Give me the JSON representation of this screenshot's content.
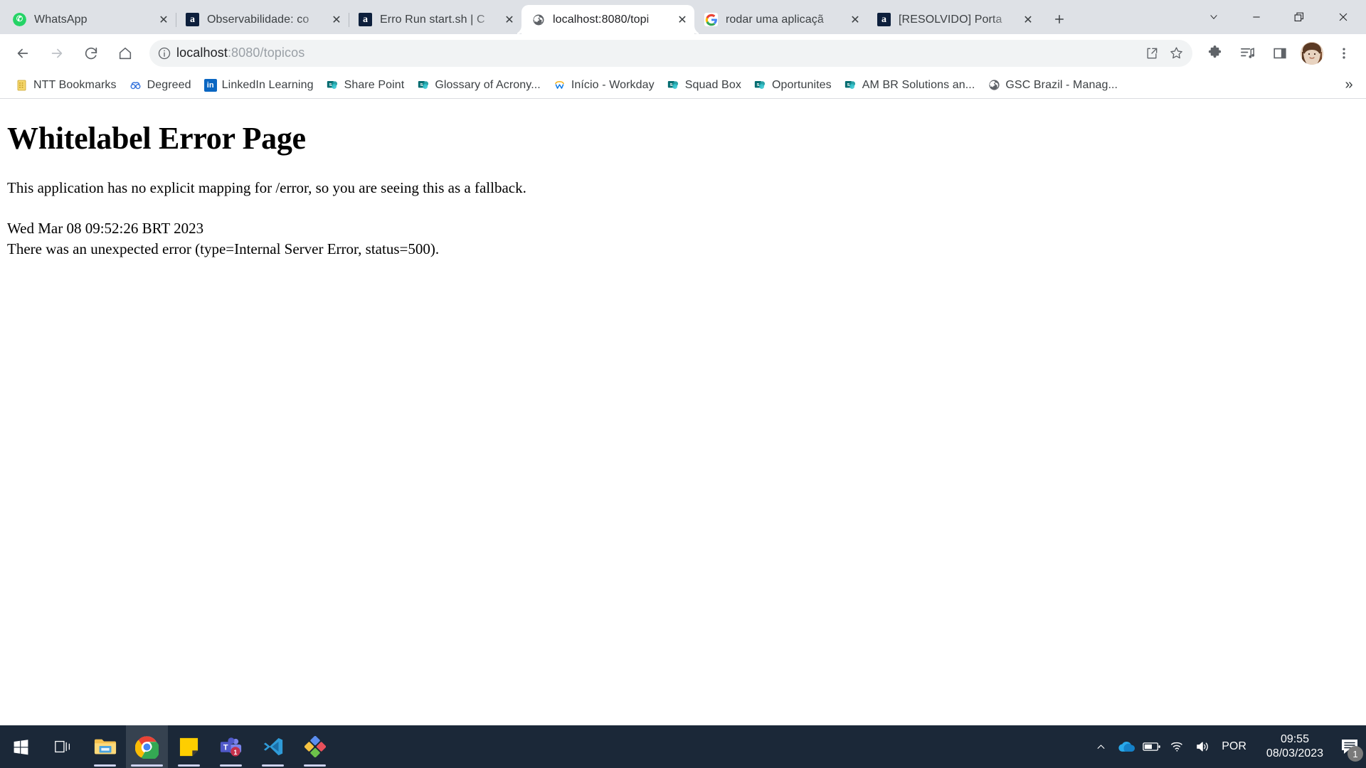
{
  "browser": {
    "tabs": [
      {
        "title": "WhatsApp",
        "favicon": "whatsapp-icon",
        "active": false
      },
      {
        "title": "Observabilidade: co",
        "favicon": "alura-icon",
        "active": false
      },
      {
        "title": "Erro Run start.sh | C",
        "favicon": "alura-icon",
        "active": false
      },
      {
        "title": "localhost:8080/topi",
        "favicon": "globe-icon",
        "active": true
      },
      {
        "title": "rodar uma aplicaçã",
        "favicon": "google-icon",
        "active": false
      },
      {
        "title": "[RESOLVIDO] Porta",
        "favicon": "alura-icon",
        "active": false
      }
    ],
    "tab_close_label": "✕",
    "new_tab_label": "+",
    "window_controls": {
      "tab_search": "tab-search-chevron",
      "minimize": "—",
      "maximize": "maximize-icon",
      "close": "✕"
    },
    "toolbar": {
      "back": "←",
      "forward": "→",
      "reload": "reload-icon",
      "home": "home-icon",
      "omnibox": {
        "site_info": "info-icon",
        "url_host": "localhost",
        "url_rest": ":8080/topicos",
        "share_icon": "share-icon",
        "bookmark_icon": "star-icon"
      },
      "extensions": "puzzle-icon",
      "media": "media-list-icon",
      "side_panel": "side-panel-icon",
      "profile": "avatar",
      "menu": "three-dot-menu-icon"
    },
    "bookmarks": {
      "items": [
        {
          "label": "NTT Bookmarks",
          "icon": "ntt-icon"
        },
        {
          "label": "Degreed",
          "icon": "degreed-icon"
        },
        {
          "label": "LinkedIn Learning",
          "icon": "linkedin-icon"
        },
        {
          "label": "Share Point",
          "icon": "sharepoint-icon"
        },
        {
          "label": "Glossary of Acrony...",
          "icon": "sharepoint-icon"
        },
        {
          "label": "Início - Workday",
          "icon": "workday-icon"
        },
        {
          "label": "Squad Box",
          "icon": "sharepoint-icon"
        },
        {
          "label": "Oportunites",
          "icon": "sharepoint-icon"
        },
        {
          "label": "AM BR Solutions an...",
          "icon": "sharepoint-icon"
        },
        {
          "label": "GSC Brazil - Manag...",
          "icon": "globe-icon"
        }
      ],
      "overflow_label": "»"
    }
  },
  "page": {
    "heading": "Whitelabel Error Page",
    "paragraph": "This application has no explicit mapping for /error, so you are seeing this as a fallback.",
    "timestamp": "Wed Mar 08 09:52:26 BRT 2023",
    "error_message": "There was an unexpected error (type=Internal Server Error, status=500)."
  },
  "taskbar": {
    "items": [
      {
        "name": "start-button",
        "icon": "windows-logo-icon",
        "state": "idle"
      },
      {
        "name": "task-view-button",
        "icon": "task-view-icon",
        "state": "idle"
      },
      {
        "name": "file-explorer",
        "icon": "folder-icon",
        "state": "running"
      },
      {
        "name": "google-chrome",
        "icon": "chrome-icon",
        "state": "focused"
      },
      {
        "name": "sticky-notes",
        "icon": "sticky-note-icon",
        "state": "running"
      },
      {
        "name": "microsoft-teams",
        "icon": "teams-icon",
        "state": "running",
        "badge": "1"
      },
      {
        "name": "visual-studio-code",
        "icon": "vscode-icon",
        "state": "running"
      },
      {
        "name": "sourcetree",
        "icon": "sourcetree-icon",
        "state": "running"
      }
    ],
    "tray": {
      "show_hidden": "chevron-up-icon",
      "onedrive": "onedrive-cloud-icon",
      "battery": "battery-icon",
      "network": "wifi-icon",
      "volume": "speaker-icon",
      "language": "POR",
      "time": "09:55",
      "date": "08/03/2023",
      "notifications_icon": "notification-center-icon",
      "notifications_count": "1"
    }
  },
  "colors": {
    "tabstrip_bg": "#dee1e6",
    "toolbar_bg": "#ffffff",
    "omnibox_bg": "#f1f3f4",
    "taskbar_bg": "#1b2838",
    "accent": "#1a73e8"
  }
}
